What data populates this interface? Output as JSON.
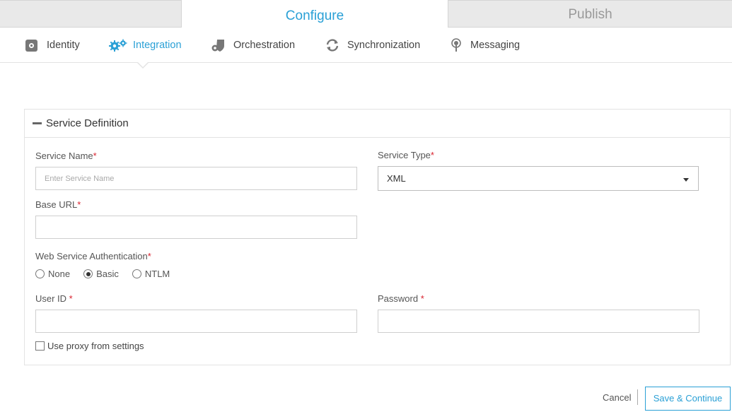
{
  "top_tabs": {
    "configure": "Configure",
    "publish": "Publish"
  },
  "subnav": {
    "items": [
      {
        "label": "Identity",
        "icon": "camera-badge-icon"
      },
      {
        "label": "Integration",
        "icon": "gears-icon",
        "active": true
      },
      {
        "label": "Orchestration",
        "icon": "shield-gears-icon"
      },
      {
        "label": "Synchronization",
        "icon": "sync-icon"
      },
      {
        "label": "Messaging",
        "icon": "broadcast-icon"
      }
    ]
  },
  "panel": {
    "title": "Service Definition"
  },
  "form": {
    "service_name_label": "Service Name",
    "service_name_placeholder": "Enter Service Name",
    "service_type_label": "Service Type",
    "service_type_value": "XML",
    "base_url_label": "Base URL",
    "auth_label": "Web Service Authentication",
    "auth_options": [
      "None",
      "Basic",
      "NTLM"
    ],
    "auth_selected": "Basic",
    "user_id_label": "User ID ",
    "password_label": "Password ",
    "proxy_label": "Use proxy from settings",
    "required_mark": "*"
  },
  "footer": {
    "cancel": "Cancel",
    "save": "Save & Continue"
  },
  "colors": {
    "accent": "#2aa0d6",
    "required": "#d9232f"
  }
}
